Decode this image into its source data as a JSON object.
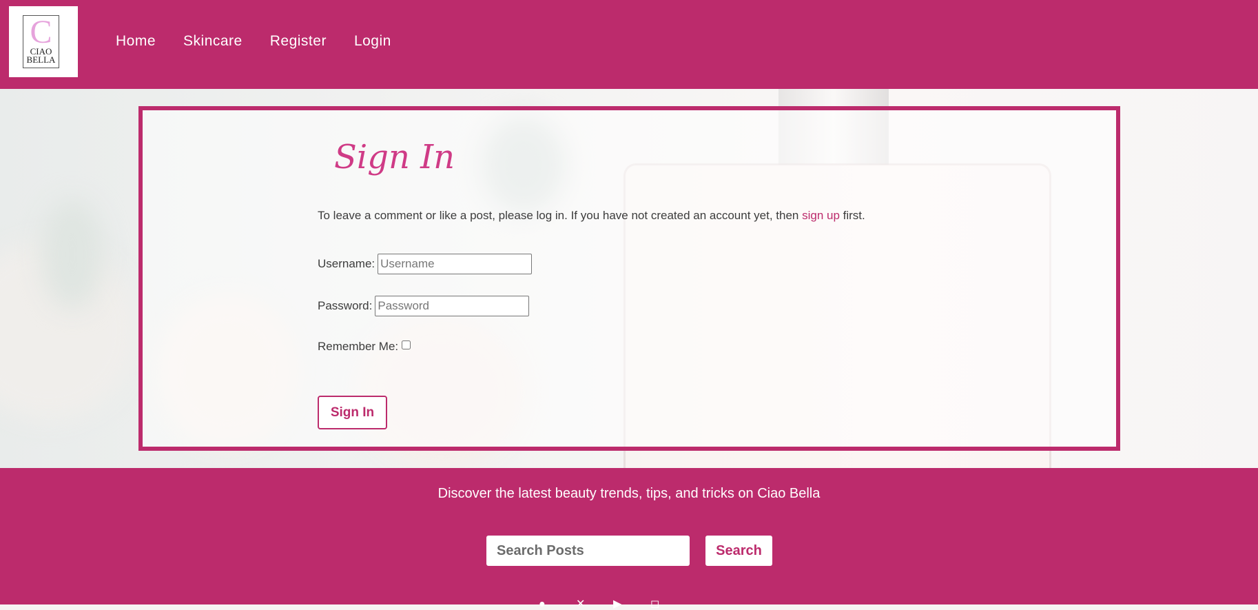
{
  "header": {
    "logo": {
      "letter": "C",
      "line1": "CIAO",
      "line2": "BELLA"
    },
    "nav": [
      "Home",
      "Skincare",
      "Register",
      "Login"
    ]
  },
  "signin": {
    "title": "Sign In",
    "intro_before": "To leave a comment or like a post, please log in. If you have not created an account yet, then ",
    "intro_link": "sign up",
    "intro_after": " first.",
    "username_label": "Username:",
    "username_placeholder": "Username",
    "password_label": "Password:",
    "password_placeholder": "Password",
    "remember_label": "Remember Me:",
    "remember_checked": false,
    "button": "Sign In"
  },
  "footer": {
    "tagline": "Discover the latest beauty trends, tips, and tricks on Ciao Bella",
    "search_placeholder": "Search Posts",
    "search_button": "Search",
    "social_icons": [
      "facebook-icon",
      "x-icon",
      "youtube-icon",
      "instagram-icon"
    ]
  },
  "colors": {
    "brand": "#bc2b6c",
    "title": "#cf3b86",
    "logo_c": "#e6a3dc"
  }
}
